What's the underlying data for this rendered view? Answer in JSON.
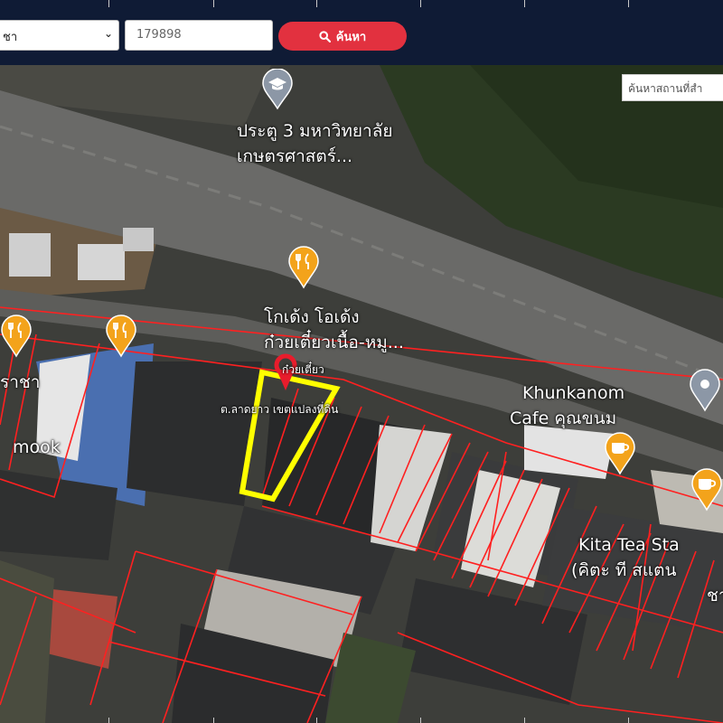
{
  "toolbar": {
    "select_value": "ชา",
    "select_chevron": "⌄",
    "input_value": "179898",
    "search_label": "ค้นหา",
    "search_icon": "search-icon"
  },
  "map": {
    "place_search_placeholder": "ค้นหาสถานที่สำ",
    "labels": {
      "university_gate": "ประตู 3 มหาวิทยาลัย",
      "university_gate_2": "เกษตรศาสตร์...",
      "noodle_shop": "โกเด้ง โอเด้ง",
      "noodle_shop_2": "ก๋วยเตี๋ยวเนื้อ-หมู...",
      "noodle_small": "ก๋วยเตี๋ยว",
      "parcel_label": "ต.ลาดยาว เขตแปลงที่ดิน",
      "left_place": "ราชา",
      "left_place_2": "mook",
      "cafe": "Khunkanom",
      "cafe_2": "Cafe คุณขนม",
      "tea": "Kita Tea Sta",
      "tea_2": "(คิตะ ที สแตน",
      "tea_3": "ชาใ"
    },
    "colors": {
      "parcel_line": "#ff2020",
      "selected_parcel": "#ffff00",
      "marker": "#e81c2c",
      "food_pin": "#f3a31b",
      "place_pin": "#8c97a6",
      "search_button": "#e2313f",
      "topbar": "#0f1b35"
    }
  }
}
